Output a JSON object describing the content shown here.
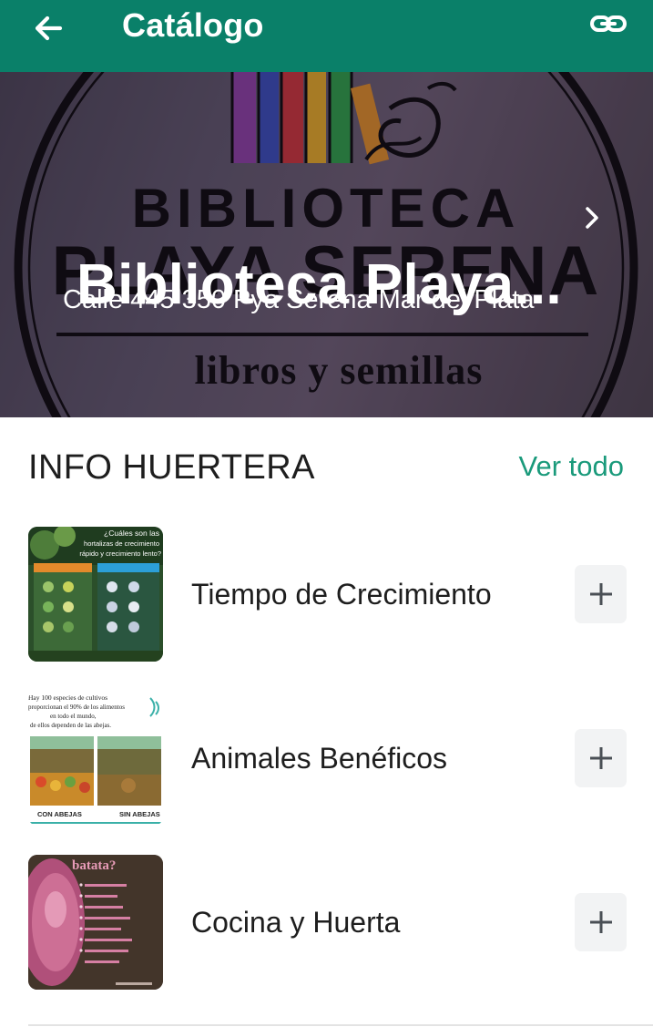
{
  "header": {
    "title": "Catálogo",
    "back_icon": "arrow-left-icon",
    "link_icon": "link-icon",
    "background_color": "#0a8069"
  },
  "store": {
    "name": "Biblioteca Playa...",
    "address": "Calle 445 350 Pya Serena Mar del Plata",
    "chevron_icon": "chevron-right-icon",
    "cover_text": {
      "line1": "BIBLIOTECA",
      "line2": "PLAYA SERENA",
      "line3": "libros y semillas"
    }
  },
  "section": {
    "title": "INFO HUERTERA",
    "view_all_label": "Ver todo",
    "accent_color": "#1a9a7b"
  },
  "items": [
    {
      "name": "Tiempo de Crecimiento",
      "add_icon": "plus-icon",
      "thumb_text": [
        "¿Cuáles son las",
        "hortalizas de crecimiento",
        "rápido y crecimiento lento?"
      ]
    },
    {
      "name": "Animales Benéficos",
      "add_icon": "plus-icon",
      "thumb_text": [
        "Hay 100 especies de cultivos",
        "proporcionan el 90% de los alimentos",
        "en todo el mundo,",
        "de ellos dependen de las abejas.",
        "CON ABEJAS",
        "SIN ABEJAS"
      ]
    },
    {
      "name": "Cocina y Huerta",
      "add_icon": "plus-icon",
      "thumb_text": [
        "batata?"
      ]
    }
  ]
}
